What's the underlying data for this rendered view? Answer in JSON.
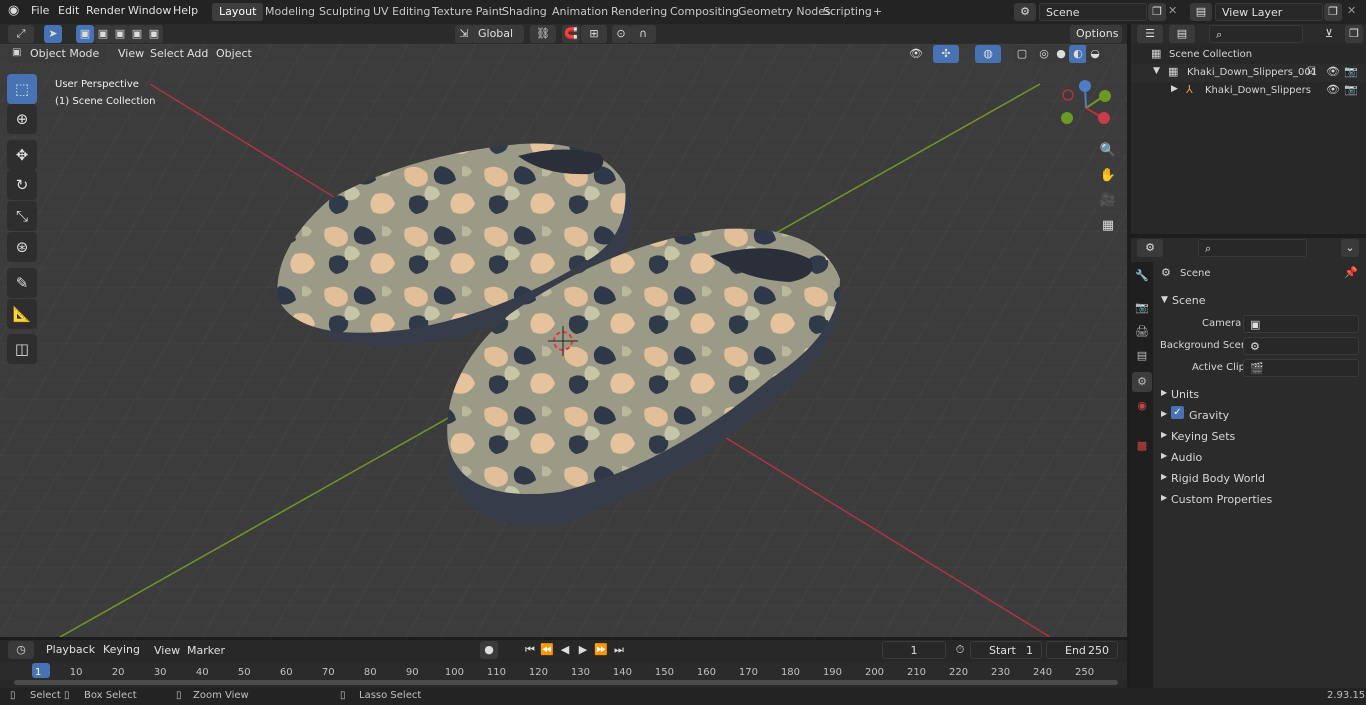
{
  "menu": [
    "File",
    "Edit",
    "Render",
    "Window",
    "Help"
  ],
  "workspaces": [
    "Layout",
    "Modeling",
    "Sculpting",
    "UV Editing",
    "Texture Paint",
    "Shading",
    "Animation",
    "Rendering",
    "Compositing",
    "Geometry Nodes",
    "Scripting",
    "+"
  ],
  "scene_name": "Scene",
  "view_layer": "View Layer",
  "header": {
    "mode": "Object Mode",
    "view": "View",
    "select": "Select",
    "add": "Add",
    "object": "Object",
    "orientation": "Global",
    "options": "Options"
  },
  "viewport": {
    "perspective": "User Perspective",
    "collection": "(1) Scene Collection"
  },
  "outliner": {
    "root": "Scene Collection",
    "collection": "Khaki_Down_Slippers_001",
    "object": "Khaki_Down_Slippers"
  },
  "properties": {
    "title": "Scene",
    "section": "Scene",
    "camera_label": "Camera",
    "background_label": "Background Scene",
    "clip_label": "Active Clip",
    "panels": [
      "Units",
      "Gravity",
      "Keying Sets",
      "Audio",
      "Rigid Body World",
      "Custom Properties"
    ]
  },
  "timeline": {
    "playback": "Playback",
    "keying": "Keying",
    "view": "View",
    "marker": "Marker",
    "current_frame": "1",
    "start_label": "Start",
    "start": "1",
    "end_label": "End",
    "end": "250",
    "ticks": [
      "1",
      "10",
      "20",
      "30",
      "40",
      "50",
      "60",
      "70",
      "80",
      "90",
      "100",
      "110",
      "120",
      "130",
      "140",
      "150",
      "160",
      "170",
      "180",
      "190",
      "200",
      "210",
      "220",
      "230",
      "240",
      "250"
    ]
  },
  "status": {
    "select": "Select",
    "box_select": "Box Select",
    "zoom": "Zoom View",
    "lasso": "Lasso Select",
    "version": "2.93.15"
  },
  "colors": {
    "accent": "#4772b3",
    "x_axis": "#b0343f",
    "y_axis": "#6b9a22",
    "camo_base": "#c9b391"
  }
}
